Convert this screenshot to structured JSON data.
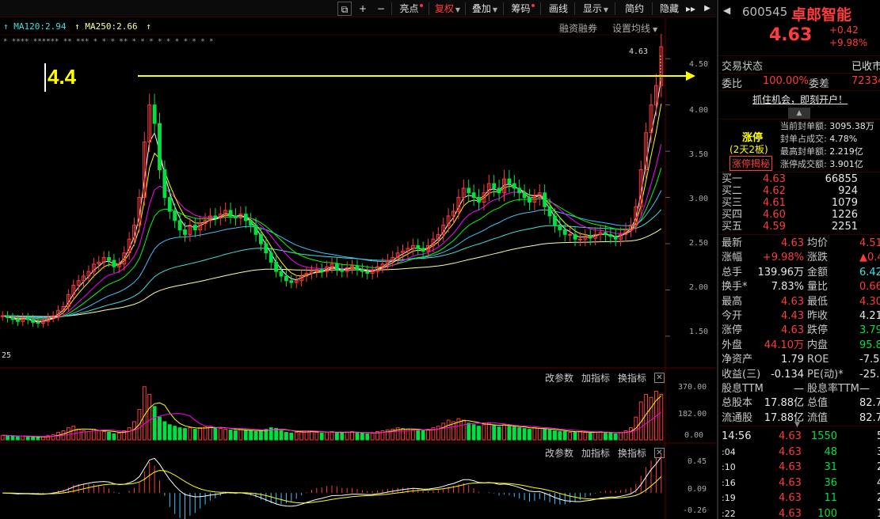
{
  "toolbar": {
    "items": [
      {
        "label": "亮点",
        "dot": true,
        "active": false
      },
      {
        "label": "复权",
        "dot": false,
        "active": true,
        "arrow": true
      },
      {
        "label": "叠加",
        "dot": false,
        "active": false,
        "arrow": true
      },
      {
        "label": "筹码",
        "dot": true,
        "active": false
      },
      {
        "label": "画线",
        "dot": false,
        "active": false
      },
      {
        "label": "显示",
        "dot": false,
        "active": false,
        "arrow": true
      },
      {
        "label": "简约",
        "dot": false,
        "active": false
      },
      {
        "label": "隐藏",
        "dot": false,
        "active": false
      }
    ],
    "icon_buttons": [
      "copy-icon",
      "plus-icon",
      "minus-icon"
    ],
    "nav_forward": "▸▸",
    "collapse": "▶"
  },
  "legend": {
    "ma120_label": "MA120:2.94",
    "ma250_label": "MA250:2.66",
    "margin_trading": "融资融券",
    "set_ma": "设置均线"
  },
  "annotation": {
    "text": "4.4"
  },
  "price_axis": {
    "labels": [
      "4.50",
      "4.00",
      "3.50",
      "3.00",
      "2.50",
      "2.00",
      "1.50"
    ],
    "current_tag": "4.63",
    "low_tag": "25"
  },
  "volume_axis": {
    "labels": [
      "370.00",
      "182.00",
      "0.00"
    ]
  },
  "macd_axis": {
    "labels": [
      "0.45",
      "0.09",
      "-0.26"
    ]
  },
  "panel_buttons": {
    "params": "改参数",
    "add": "加指标",
    "switch": "换指标",
    "close": "✕"
  },
  "stock": {
    "code": "600545",
    "name": "卓郎智能",
    "price": "4.63",
    "change": "+0.42",
    "change_pct": "+9.98%",
    "trade_status_label": "交易状态",
    "trade_status": "已收市",
    "weibi_label": "委比",
    "weibi": "100.00%",
    "weicha_label": "委差",
    "weicha": "72334",
    "ad": "抓住机会，即刻开户！"
  },
  "limit_up": {
    "title": "涨停",
    "subtitle": "(2天2板)",
    "reveal": "涨停揭秘",
    "rows": [
      {
        "label": "当前封单额:",
        "value": "3095.38万"
      },
      {
        "label": "封单占成交:",
        "value": "4.78%"
      },
      {
        "label": "最高封单额:",
        "value": "2.219亿"
      },
      {
        "label": "涨停成交额:",
        "value": "3.901亿"
      }
    ]
  },
  "bids": [
    {
      "label": "买一",
      "price": "4.63",
      "vol": "66855"
    },
    {
      "label": "买二",
      "price": "4.62",
      "vol": "924"
    },
    {
      "label": "买三",
      "price": "4.61",
      "vol": "1079"
    },
    {
      "label": "买四",
      "price": "4.60",
      "vol": "1226"
    },
    {
      "label": "买五",
      "price": "4.59",
      "vol": "2251"
    }
  ],
  "stats": [
    {
      "l1": "最新",
      "v1": "4.63",
      "c1": "red",
      "l2": "均价",
      "v2": "4.51",
      "c2": "red"
    },
    {
      "l1": "涨幅",
      "v1": "+9.98%",
      "c1": "red",
      "l2": "涨跌",
      "v2": "▲0.42",
      "c2": "red"
    },
    {
      "l1": "总手",
      "v1": "139.96万",
      "c1": "white",
      "l2": "金额",
      "v2": "6.42亿",
      "c2": "cyan"
    },
    {
      "l1": "换手*",
      "v1": "7.83%",
      "c1": "white",
      "l2": "量比",
      "v2": "0.66",
      "c2": "red"
    },
    {
      "l1": "最高",
      "v1": "4.63",
      "c1": "red",
      "l2": "最低",
      "v2": "4.30",
      "c2": "red"
    },
    {
      "l1": "今开",
      "v1": "4.43",
      "c1": "red",
      "l2": "昨收",
      "v2": "4.21",
      "c2": "white"
    },
    {
      "l1": "涨停",
      "v1": "4.63",
      "c1": "red",
      "l2": "跌停",
      "v2": "3.79",
      "c2": "green"
    },
    {
      "l1": "外盘",
      "v1": "44.10万",
      "c1": "red",
      "l2": "内盘",
      "v2": "95.87万",
      "c2": "green"
    },
    {
      "l1": "净资产",
      "v1": "1.79",
      "c1": "white",
      "l2": "ROE",
      "v2": "-7.55%",
      "c2": "white"
    },
    {
      "l1": "收益(三)",
      "v1": "-0.134",
      "c1": "white",
      "l2": "PE(动)*",
      "v2": "-25.96",
      "c2": "white"
    },
    {
      "l1": "股息TTM",
      "v1": "—",
      "c1": "white",
      "l2": "股息率TTM",
      "v2": "—",
      "c2": "white"
    },
    {
      "l1": "总股本",
      "v1": "17.88亿",
      "c1": "white",
      "l2": "总值",
      "v2": "82.78亿",
      "c2": "white"
    },
    {
      "l1": "流通股",
      "v1": "17.88亿",
      "c1": "white",
      "l2": "流值",
      "v2": "82.78亿",
      "c2": "white"
    }
  ],
  "ticks": [
    {
      "time": "14:56",
      "price": "4.63",
      "vol": "1550",
      "n": "5"
    },
    {
      "time": ":04",
      "price": "4.63",
      "vol": "48",
      "n": "3"
    },
    {
      "time": ":10",
      "price": "4.63",
      "vol": "31",
      "n": "2"
    },
    {
      "time": ":16",
      "price": "4.63",
      "vol": "36",
      "n": "4"
    },
    {
      "time": ":19",
      "price": "4.63",
      "vol": "11",
      "n": "2"
    },
    {
      "time": ":22",
      "price": "4.63",
      "vol": "100",
      "n": "1"
    }
  ],
  "colors": {
    "up": "#ff3b3b",
    "down": "#00e040",
    "ma5": "#ffffff",
    "ma10": "#ffff00",
    "ma20": "#ff00ff",
    "ma30": "#00ff00",
    "ma60": "#40c0ff",
    "ma120": "#40e0e0",
    "ma250": "#ffffa0"
  },
  "chart_data": {
    "type": "candlestick",
    "ylim": [
      1.2,
      4.75
    ],
    "closes": [
      1.72,
      1.7,
      1.68,
      1.66,
      1.7,
      1.68,
      1.65,
      1.64,
      1.66,
      1.7,
      1.72,
      1.78,
      1.82,
      1.95,
      2.05,
      2.1,
      2.15,
      2.2,
      2.28,
      2.3,
      2.35,
      2.32,
      2.25,
      2.28,
      2.4,
      2.55,
      2.7,
      3.0,
      3.6,
      4.0,
      3.8,
      3.3,
      3.0,
      2.85,
      2.75,
      2.65,
      2.6,
      2.7,
      2.65,
      2.72,
      2.75,
      2.8,
      2.78,
      2.82,
      2.86,
      2.8,
      2.78,
      2.82,
      2.75,
      2.7,
      2.6,
      2.5,
      2.4,
      2.3,
      2.2,
      2.15,
      2.1,
      2.08,
      2.1,
      2.15,
      2.18,
      2.2,
      2.22,
      2.2,
      2.25,
      2.28,
      2.22,
      2.2,
      2.24,
      2.26,
      2.22,
      2.2,
      2.18,
      2.2,
      2.25,
      2.28,
      2.32,
      2.35,
      2.4,
      2.42,
      2.45,
      2.48,
      2.45,
      2.42,
      2.48,
      2.55,
      2.6,
      2.7,
      2.8,
      2.85,
      3.0,
      3.1,
      3.05,
      3.0,
      2.95,
      3.05,
      3.15,
      3.1,
      3.05,
      3.2,
      3.15,
      3.1,
      3.05,
      3.0,
      2.95,
      3.0,
      3.05,
      2.9,
      2.8,
      2.7,
      2.65,
      2.6,
      2.6,
      2.55,
      2.55,
      2.58,
      2.56,
      2.6,
      2.62,
      2.6,
      2.58,
      2.55,
      2.6,
      2.65,
      2.7,
      2.9,
      3.3,
      3.7,
      4.0,
      4.21,
      4.63
    ],
    "volumes": [
      30,
      28,
      25,
      22,
      25,
      20,
      18,
      18,
      20,
      28,
      35,
      50,
      60,
      80,
      90,
      70,
      60,
      55,
      70,
      60,
      55,
      50,
      40,
      45,
      60,
      80,
      120,
      200,
      350,
      300,
      220,
      150,
      120,
      100,
      90,
      80,
      75,
      80,
      70,
      80,
      85,
      90,
      80,
      75,
      70,
      65,
      60,
      70,
      65,
      60,
      55,
      60,
      70,
      80,
      75,
      60,
      50,
      45,
      50,
      55,
      60,
      55,
      50,
      45,
      50,
      55,
      50,
      45,
      50,
      55,
      50,
      45,
      40,
      45,
      55,
      60,
      65,
      70,
      80,
      75,
      70,
      65,
      60,
      60,
      70,
      80,
      90,
      110,
      130,
      120,
      140,
      130,
      110,
      100,
      90,
      100,
      110,
      95,
      85,
      100,
      90,
      85,
      80,
      75,
      70,
      80,
      75,
      70,
      65,
      60,
      55,
      55,
      50,
      50,
      55,
      50,
      45,
      50,
      55,
      50,
      45,
      40,
      50,
      60,
      80,
      150,
      250,
      300,
      280,
      320,
      300
    ]
  }
}
